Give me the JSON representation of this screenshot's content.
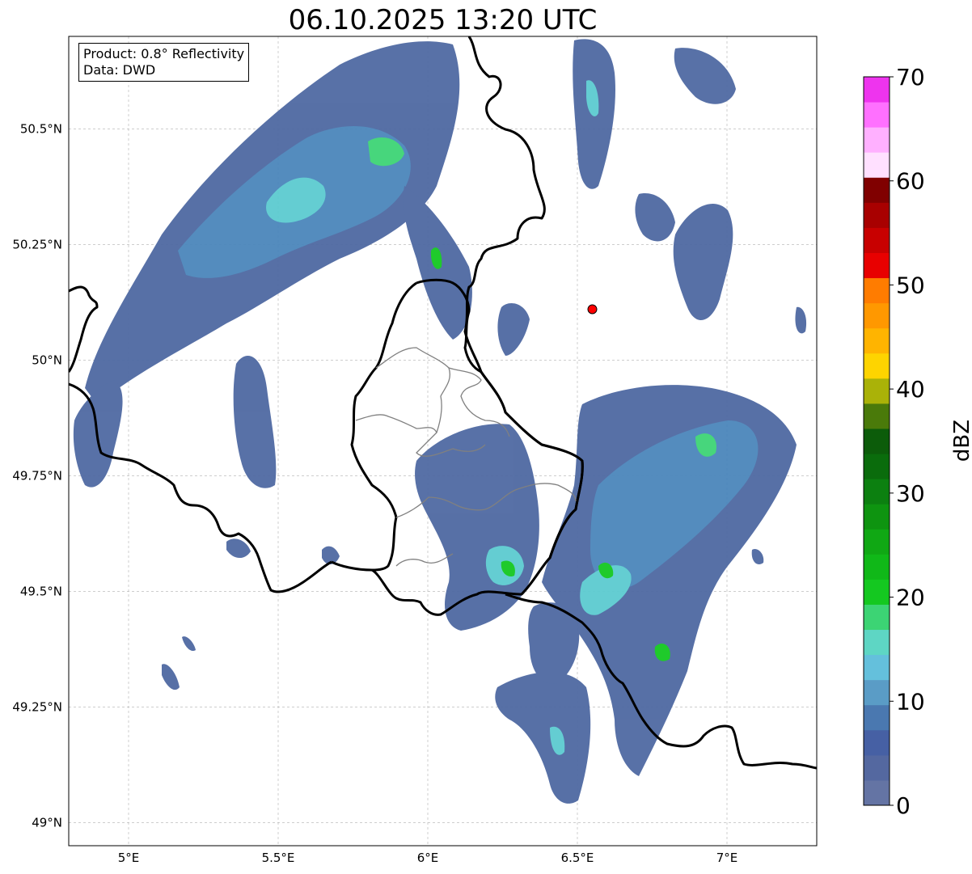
{
  "title": "06.10.2025 13:20 UTC",
  "info": {
    "product": "Product: 0.8° Reflectivity",
    "source": "Data: DWD"
  },
  "axes": {
    "lon_labels": [
      "5°E",
      "5.5°E",
      "6°E",
      "6.5°E",
      "7°E"
    ],
    "lat_labels": [
      "50.5°N",
      "50.25°N",
      "50°N",
      "49.75°N",
      "49.5°N",
      "49.25°N",
      "49°N"
    ],
    "lon_values": [
      5.0,
      5.5,
      6.0,
      6.5,
      7.0
    ],
    "lat_values": [
      50.5,
      50.25,
      50.0,
      49.75,
      49.5,
      49.25,
      49.0
    ],
    "lon_range": [
      4.8,
      7.3
    ],
    "lat_range": [
      48.95,
      50.7
    ],
    "grid": true
  },
  "radar_site": {
    "lon": 6.55,
    "lat": 50.11,
    "color": "#ff0000"
  },
  "colorbar": {
    "label": "dBZ",
    "ticks": [
      "0",
      "10",
      "20",
      "30",
      "40",
      "50",
      "60",
      "70"
    ],
    "tick_values": [
      0,
      10,
      20,
      30,
      40,
      50,
      60,
      70
    ],
    "colors": [
      "#6474a4",
      "#5468a0",
      "#4660a4",
      "#4a78b0",
      "#5a9cc6",
      "#64c0dc",
      "#5ed6c4",
      "#3cd474",
      "#14c820",
      "#10b818",
      "#10a814",
      "#0e9410",
      "#0c8010",
      "#0a6c0c",
      "#0c5c0a",
      "#4a7a0a",
      "#aab208",
      "#fed400",
      "#ffb400",
      "#ff9800",
      "#ff7c00",
      "#e80000",
      "#c80000",
      "#a80000",
      "#800000",
      "#ffe0ff",
      "#ffb0ff",
      "#ff70ff",
      "#ee34ee"
    ]
  }
}
